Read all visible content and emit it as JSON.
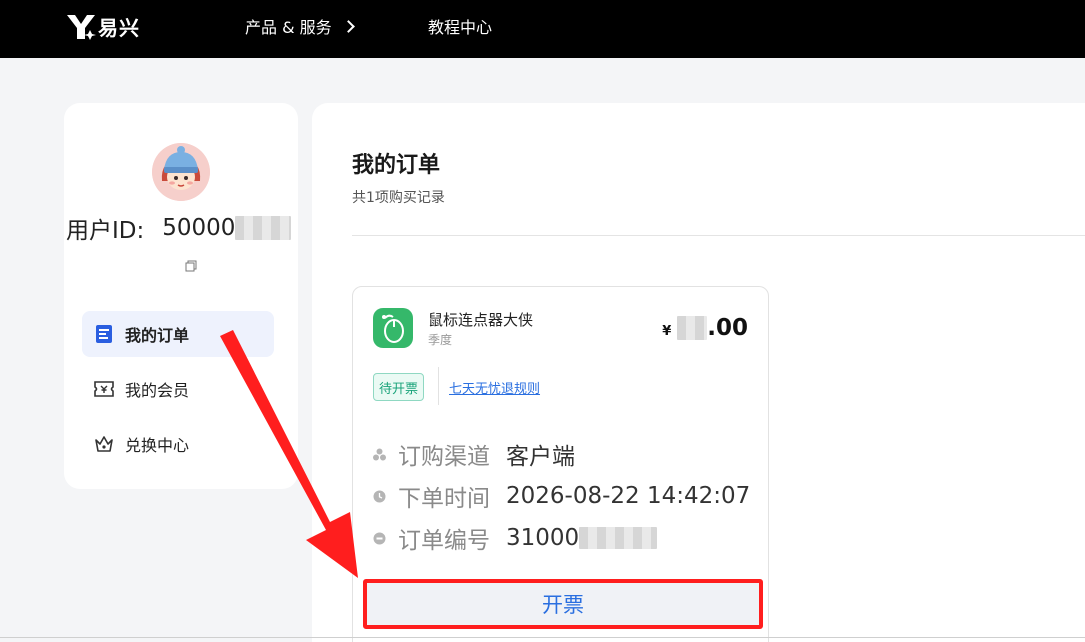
{
  "header": {
    "logo_text": "易兴",
    "nav": [
      {
        "label": "产品 & 服务"
      },
      {
        "label": "教程中心"
      }
    ]
  },
  "sidebar": {
    "user_id_label": "用户ID:",
    "user_id_value": "50000",
    "menu": [
      {
        "label": "我的订单",
        "icon": "receipt-icon",
        "active": true
      },
      {
        "label": "我的会员",
        "icon": "ticket-icon",
        "active": false
      },
      {
        "label": "兑换中心",
        "icon": "crown-icon",
        "active": false
      }
    ]
  },
  "main": {
    "title": "我的订单",
    "subtitle": "共1项购买记录",
    "order": {
      "product_name": "鼠标连点器大侠",
      "period": "季度",
      "currency": "¥",
      "price_suffix": ".00",
      "status_tag": "待开票",
      "refund_rule_link": "七天无忧退规则",
      "rows": [
        {
          "label": "订购渠道",
          "value": "客户端",
          "icon": "channel-icon"
        },
        {
          "label": "下单时间",
          "value": "2026-08-22 14:42:07",
          "icon": "clock-icon"
        },
        {
          "label": "订单编号",
          "value": "31000",
          "icon": "order-number-icon"
        }
      ],
      "invoice_button": "开票"
    }
  },
  "colors": {
    "accent_blue": "#2a6fe0",
    "tag_green": "#1aa37a",
    "highlight_red": "#ff1e1e",
    "app_green": "#35b86a"
  }
}
